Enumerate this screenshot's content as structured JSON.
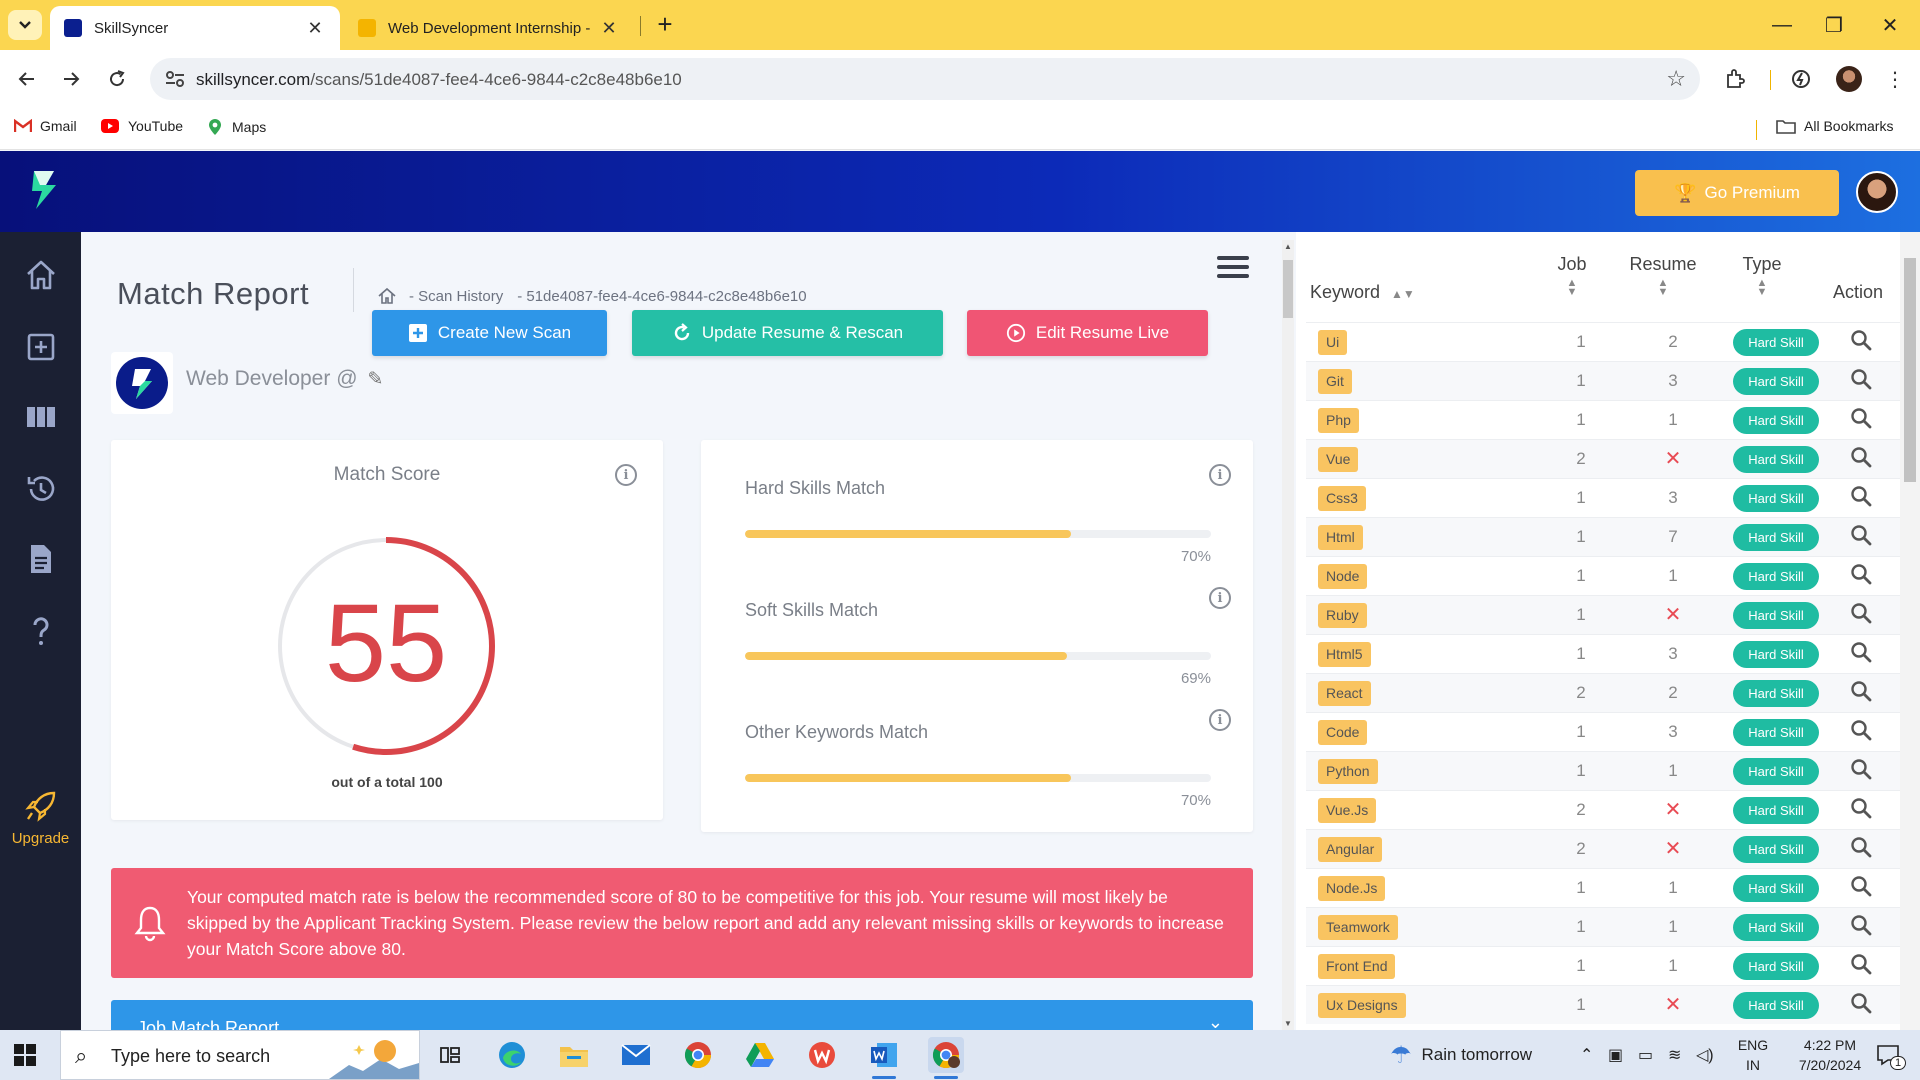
{
  "browser": {
    "tabs": [
      {
        "title": "SkillSyncer",
        "active": true
      },
      {
        "title": "Web Development Internship -",
        "active": false
      }
    ],
    "url_domain": "skillsyncer.com",
    "url_path": "/scans/51de4087-fee4-4ce6-9844-c2c8e48b6e10",
    "bookmarks": [
      "Gmail",
      "YouTube",
      "Maps"
    ],
    "all_bookmarks": "All Bookmarks"
  },
  "app": {
    "premium_label": "Go Premium",
    "brand_colors": {
      "header_start": "#07107a",
      "header_end": "#1d6fe0",
      "accent_yellow": "#f9c04e"
    }
  },
  "sidebar": {
    "items": [
      {
        "icon": "home-icon"
      },
      {
        "icon": "add-scan-icon"
      },
      {
        "icon": "columns-icon"
      },
      {
        "icon": "history-icon"
      },
      {
        "icon": "document-icon"
      },
      {
        "icon": "help-icon"
      }
    ],
    "upgrade_label": "Upgrade"
  },
  "main": {
    "title": "Match Report",
    "breadcrumb": {
      "scan_history": "- Scan History",
      "scan_id": "- 51de4087-fee4-4ce6-9844-c2c8e48b6e10"
    },
    "buttons": {
      "create": "Create New Scan",
      "update": "Update Resume & Rescan",
      "edit": "Edit Resume Live"
    },
    "job_title": "Web Developer @",
    "match_score": {
      "title": "Match Score",
      "value": "55",
      "fraction": 0.55,
      "subtitle": "out of a total 100"
    },
    "skills": [
      {
        "label": "Hard Skills Match",
        "pct_text": "70%",
        "value": 0.7
      },
      {
        "label": "Soft Skills Match",
        "pct_text": "69%",
        "value": 0.69
      },
      {
        "label": "Other Keywords Match",
        "pct_text": "70%",
        "value": 0.7
      }
    ],
    "alert": "Your computed match rate is below the recommended score of 80 to be competitive for this job. Your resume will most likely be skipped by the Applicant Tracking System. Please review the below report and add any relevant missing skills or keywords to increase your Match Score above 80.",
    "report_bar": "Job Match Report"
  },
  "keywords": {
    "headers": {
      "keyword": "Keyword",
      "job": "Job",
      "resume": "Resume",
      "type": "Type",
      "action": "Action"
    },
    "rows": [
      {
        "keyword": "Ui",
        "job": "1",
        "resume": "2",
        "type": "Hard Skill"
      },
      {
        "keyword": "Git",
        "job": "1",
        "resume": "3",
        "type": "Hard Skill"
      },
      {
        "keyword": "Php",
        "job": "1",
        "resume": "1",
        "type": "Hard Skill"
      },
      {
        "keyword": "Vue",
        "job": "2",
        "resume": "✕",
        "type": "Hard Skill"
      },
      {
        "keyword": "Css3",
        "job": "1",
        "resume": "3",
        "type": "Hard Skill"
      },
      {
        "keyword": "Html",
        "job": "1",
        "resume": "7",
        "type": "Hard Skill"
      },
      {
        "keyword": "Node",
        "job": "1",
        "resume": "1",
        "type": "Hard Skill"
      },
      {
        "keyword": "Ruby",
        "job": "1",
        "resume": "✕",
        "type": "Hard Skill"
      },
      {
        "keyword": "Html5",
        "job": "1",
        "resume": "3",
        "type": "Hard Skill"
      },
      {
        "keyword": "React",
        "job": "2",
        "resume": "2",
        "type": "Hard Skill"
      },
      {
        "keyword": "Code",
        "job": "1",
        "resume": "3",
        "type": "Hard Skill"
      },
      {
        "keyword": "Python",
        "job": "1",
        "resume": "1",
        "type": "Hard Skill"
      },
      {
        "keyword": "Vue.Js",
        "job": "2",
        "resume": "✕",
        "type": "Hard Skill"
      },
      {
        "keyword": "Angular",
        "job": "2",
        "resume": "✕",
        "type": "Hard Skill"
      },
      {
        "keyword": "Node.Js",
        "job": "1",
        "resume": "1",
        "type": "Hard Skill"
      },
      {
        "keyword": "Teamwork",
        "job": "1",
        "resume": "1",
        "type": "Hard Skill"
      },
      {
        "keyword": "Front End",
        "job": "1",
        "resume": "1",
        "type": "Hard Skill"
      },
      {
        "keyword": "Ux Designs",
        "job": "1",
        "resume": "✕",
        "type": "Hard Skill"
      }
    ]
  },
  "taskbar": {
    "search_placeholder": "Type here to search",
    "weather": "Rain tomorrow",
    "lang_1": "ENG",
    "lang_2": "IN",
    "time": "4:22 PM",
    "date": "7/20/2024",
    "notification_count": "1"
  }
}
